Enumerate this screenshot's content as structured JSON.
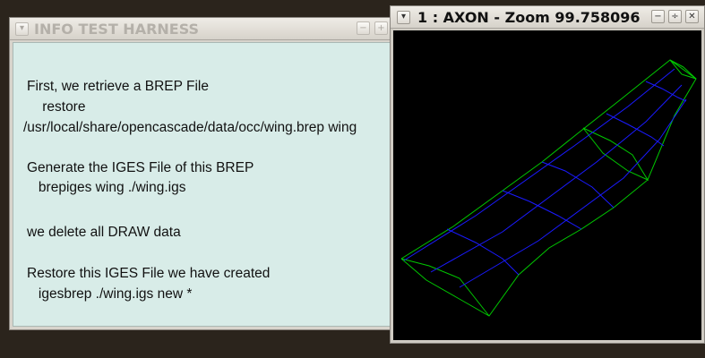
{
  "info_window": {
    "title": "INFO TEST HARNESS",
    "menu_glyph": "▾",
    "minimize_glyph": "−",
    "maximize_glyph": "+",
    "lines": [
      "First, we retrieve a BREP File",
      "    restore",
      "/usr/local/share/opencascade/data/occ/wing.brep wing",
      "Generate the IGES File of this BREP",
      "   brepiges wing ./wing.igs",
      "we delete all DRAW data",
      "Restore this IGES File we have created",
      "   igesbrep ./wing.igs new *"
    ]
  },
  "axon_window": {
    "title": "1 : AXON - Zoom 99.758096",
    "menu_glyph": "▾",
    "minimize_glyph": "−",
    "maximize_glyph": "÷",
    "close_glyph": "✕",
    "viewport_background": "#000000",
    "wire_colors": {
      "edges": "#00c800",
      "isolines": "#1a1aff"
    }
  }
}
